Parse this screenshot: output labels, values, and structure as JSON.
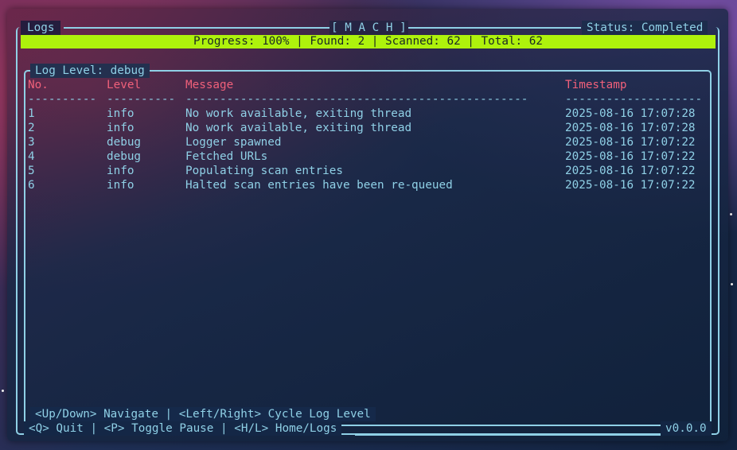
{
  "header": {
    "left_title": "Logs",
    "center_title": "[ M A C H ]",
    "status": "Status: Completed"
  },
  "progress": {
    "text": "Progress: 100% | Found: 2 | Scanned: 62 | Total: 62",
    "percent": 100
  },
  "log_panel": {
    "title": "Log Level: debug",
    "columns": [
      "No.",
      "Level",
      "Message",
      "Timestamp"
    ],
    "separators": [
      "----------",
      "----------",
      "--------------------------------------------------",
      "--------------------"
    ],
    "rows": [
      {
        "no": "1",
        "level": "info",
        "message": "No work available, exiting thread",
        "timestamp": "2025-08-16 17:07:28"
      },
      {
        "no": "2",
        "level": "info",
        "message": "No work available, exiting thread",
        "timestamp": "2025-08-16 17:07:28"
      },
      {
        "no": "3",
        "level": "debug",
        "message": "Logger spawned",
        "timestamp": "2025-08-16 17:07:22"
      },
      {
        "no": "4",
        "level": "debug",
        "message": "Fetched URLs",
        "timestamp": "2025-08-16 17:07:22"
      },
      {
        "no": "5",
        "level": "info",
        "message": "Populating scan entries",
        "timestamp": "2025-08-16 17:07:22"
      },
      {
        "no": "6",
        "level": "info",
        "message": "Halted scan entries have been re-queued",
        "timestamp": "2025-08-16 17:07:22"
      }
    ],
    "footer_hint": "<Up/Down> Navigate | <Left/Right> Cycle Log Level"
  },
  "footer": {
    "keys": "<Q> Quit | <P> Toggle Pause | <H/L> Home/Logs",
    "version": "v0.0.0"
  },
  "colors": {
    "accent": "#8fd0e6",
    "header_text": "#f0607a",
    "progress_bar": "#aef20c"
  }
}
